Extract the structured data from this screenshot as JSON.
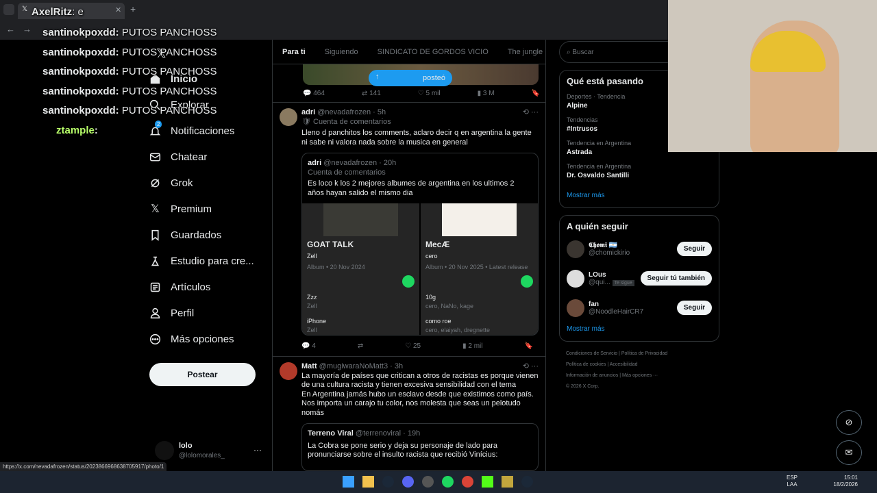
{
  "browser": {
    "tab_title": "",
    "url": ""
  },
  "overlay": {
    "streamer": "AxelRitz",
    "streamer_text": ": e",
    "messages": [
      {
        "user": "santinokpoxdd",
        "text": "PUTOS PANCHOSS"
      },
      {
        "user": "santinokpoxdd",
        "text": "PUTOS PANCHOSS"
      },
      {
        "user": "santinokpoxdd",
        "text": "PUTOS PANCHOSS"
      },
      {
        "user": "santinokpoxdd",
        "text": "PUTOS PANCHOSS"
      },
      {
        "user": "santinokpoxdd",
        "text": "PUTOS PANCHOSS"
      },
      {
        "user": "ztample",
        "text": ""
      }
    ]
  },
  "nav": {
    "items": [
      "Inicio",
      "Explorar",
      "Notificaciones",
      "Chatear",
      "Grok",
      "Premium",
      "Guardados",
      "Estudio para cre...",
      "Artículos",
      "Perfil",
      "Más opciones"
    ],
    "notif_count": "2",
    "post_button": "Postear",
    "user_name": "lolo",
    "user_handle": "@lolomorales_",
    "more": "···"
  },
  "feed": {
    "tabs": [
      "Para ti",
      "Siguiendo",
      "SINDICATO DE GORDOS VICIO",
      "The jungle"
    ],
    "posted_pill": "posteó",
    "top_actions": {
      "replies": "464",
      "reposts": "141",
      "likes": "5 mil",
      "views": "3 M"
    },
    "post1": {
      "name": "adri",
      "handle": "@nevadafrozen · 5h",
      "community": "Cuenta de comentarios",
      "text": "Lleno d panchitos los comments, aclaro decir q en argentina la gente ni sabe ni valora nada sobre la musica en general",
      "quote": {
        "name": "adri",
        "handle": "@nevadafrozen · 20h",
        "community": "Cuenta de comentarios",
        "text": "Es loco k los 2 mejores albumes de argentina en los ultimos 2 años hayan salido el mismo dia",
        "cards": [
          {
            "title": "GOAT TALK",
            "artist": "Zell",
            "meta": "Album • 20 Nov 2024",
            "tracks": [
              {
                "name": "Zzz",
                "by": "Zell"
              },
              {
                "name": "iPhone",
                "by": "Zell"
              }
            ]
          },
          {
            "title": "MecÆ",
            "artist": "cero",
            "meta": "Album • 20 Nov 2025 • Latest release",
            "tracks": [
              {
                "name": "10g",
                "by": "cero, NaNo, kage"
              },
              {
                "name": "como roe",
                "by": "cero, elaiyah, dregnette"
              }
            ]
          }
        ]
      },
      "actions": {
        "replies": "4",
        "reposts": "",
        "likes": "25",
        "views": "2 mil"
      }
    },
    "post2": {
      "name": "Matt",
      "handle": "@mugiwaraNoMatt3 · 3h",
      "text1": "La mayoría de países que critican a otros de racistas es porque vienen de una cultura racista y tienen excesiva sensibilidad con el tema",
      "text2": "En Argentina jamás hubo un esclavo desde que existimos como país. Nos importa un carajo tu color, nos molesta que seas un pelotudo nomás",
      "quote": {
        "name": "Terreno Viral",
        "handle": "@terrenoviral · 19h",
        "text": "La Cobra se pone serio y deja su personaje de lado para pronunciarse sobre el insulto racista que recibió Vinícius:"
      }
    }
  },
  "right": {
    "search_placeholder": "Buscar",
    "trends_title": "Qué está pasando",
    "trends": [
      {
        "ctx": "Deportes · Tendencia",
        "name": "Alpine"
      },
      {
        "ctx": "Tendencias",
        "name": "#Intrusos"
      },
      {
        "ctx": "Tendencia en Argentina",
        "name": "Astrada"
      },
      {
        "ctx": "Tendencia en Argentina",
        "name": "Dr. Osvaldo Santilli"
      }
    ],
    "show_more": "Mostrar más",
    "follow_title": "A quién seguir",
    "follows": [
      {
        "name": "𝕮𝖍𝖔𝖒𝖎 🇦🇷",
        "handle": "@chomickirio",
        "btn": "Seguir",
        "badge": ""
      },
      {
        "name": "LOus",
        "handle": "@qui...",
        "btn": "Seguir tú también",
        "badge": "Te sigue"
      },
      {
        "name": "fan",
        "handle": "@NoodleHairCR7",
        "btn": "Seguir",
        "badge": ""
      }
    ],
    "footer": [
      "Condiciones de Servicio",
      "Política de Privacidad",
      "Política de cookies",
      "Accesibilidad",
      "Información de anuncios",
      "Más opciones ···",
      "© 2026 X Corp."
    ]
  },
  "status_url": "https://x.com/nevadafrozen/status/2023866968638705917/photo/1",
  "taskbar": {
    "lang": "ESP",
    "lang2": "LAA",
    "time": "15:01",
    "date": "18/2/2026"
  }
}
